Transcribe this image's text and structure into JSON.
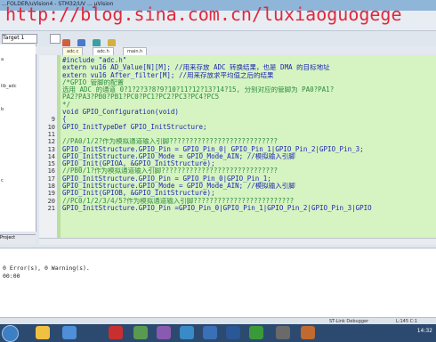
{
  "window": {
    "title": "...FOLDER/uVision4 - STM32/UV ... µVision"
  },
  "watermark": "http://blog.sina.com.cn/luxiaoguogege",
  "toolbar": {
    "target_combo": "Target 1"
  },
  "project_panel": {
    "items": [
      "a",
      "lib_adc",
      "b",
      "c"
    ],
    "tab": "Project"
  },
  "tabs": [
    {
      "label": "adc.c"
    },
    {
      "label": "adc.h"
    },
    {
      "label": "main.h"
    }
  ],
  "code": {
    "line_numbers": [
      "",
      "",
      "",
      "",
      "",
      "",
      "",
      "",
      "9",
      "10",
      "11",
      "12",
      "13",
      "14",
      "15",
      "16",
      "17",
      "18",
      "19",
      "20",
      "21"
    ],
    "lines": [
      {
        "text": "#include \"adc.h\"",
        "cls": "k"
      },
      {
        "text": "extern vu16 AD_Value[N][M];  //用来存放 ADC 转换结果，也是 DMA 的目标地址",
        "cls": "k"
      },
      {
        "text": "extern vu16 After_filter[M];  //用来存放求平均值之后的结果",
        "cls": "k"
      },
      {
        "text": "/*GPIO 管脚的配置",
        "cls": "c"
      },
      {
        "text": "选用 ADC 的通道 0?1?2?3?8?9?10?11?12?13?14?15, 分别对应的管脚为 PA0?PA1?",
        "cls": "c"
      },
      {
        "text": "PA2?PA3?PB0?PB1?PC0?PC1?PC2?PC3?PC4?PC5",
        "cls": "c"
      },
      {
        "text": "*/",
        "cls": "c"
      },
      {
        "text": "void GPIO_Configuration(void)",
        "cls": "k"
      },
      {
        "text": "{",
        "cls": "k"
      },
      {
        "text": " GPIO_InitTypeDef GPIO_InitStructure;",
        "cls": "k"
      },
      {
        "text": "",
        "cls": "k"
      },
      {
        "text": " //PA0/1/2?作为模拟通道输入引脚???????????????????????????",
        "cls": "c"
      },
      {
        "text": " GPIO_InitStructure.GPIO_Pin = GPIO_Pin_0| GPIO_Pin_1|GPIO_Pin_2|GPIO_Pin_3;",
        "cls": "k"
      },
      {
        "text": " GPIO_InitStructure.GPIO_Mode = GPIO_Mode_AIN;      //模拟输入引脚",
        "cls": "k"
      },
      {
        "text": " GPIO_Init(GPIOA, &GPIO_InitStructure);",
        "cls": "k"
      },
      {
        "text": " //PB0/1?作为模拟通道输入引脚?????????????????????????????",
        "cls": "c"
      },
      {
        "text": " GPIO_InitStructure.GPIO_Pin = GPIO_Pin_0|GPIO_Pin_1;",
        "cls": "k"
      },
      {
        "text": " GPIO_InitStructure.GPIO_Mode = GPIO_Mode_AIN;   //模拟输入引脚",
        "cls": "k"
      },
      {
        "text": " GPIO_Init(GPIOB, &GPIO_InitStructure);",
        "cls": "k"
      },
      {
        "text": " //PC0/1/2/3/4/5?作为模拟通道输入引脚?????????????????????????",
        "cls": "c"
      },
      {
        "text": " GPIO_InitStructure.GPIO_Pin  =GPIO_Pin_0|GPIO_Pin_1|GPIO_Pin_2|GPIO_Pin_3|GPIO",
        "cls": "k"
      }
    ]
  },
  "output": {
    "lines": [
      "0 Error(s), 0 Warning(s).",
      "00:00"
    ]
  },
  "status": {
    "left": "",
    "right": "ST-Link Debugger",
    "pos": "L:145 C:1"
  },
  "taskbar": {
    "clock": "14:32"
  }
}
